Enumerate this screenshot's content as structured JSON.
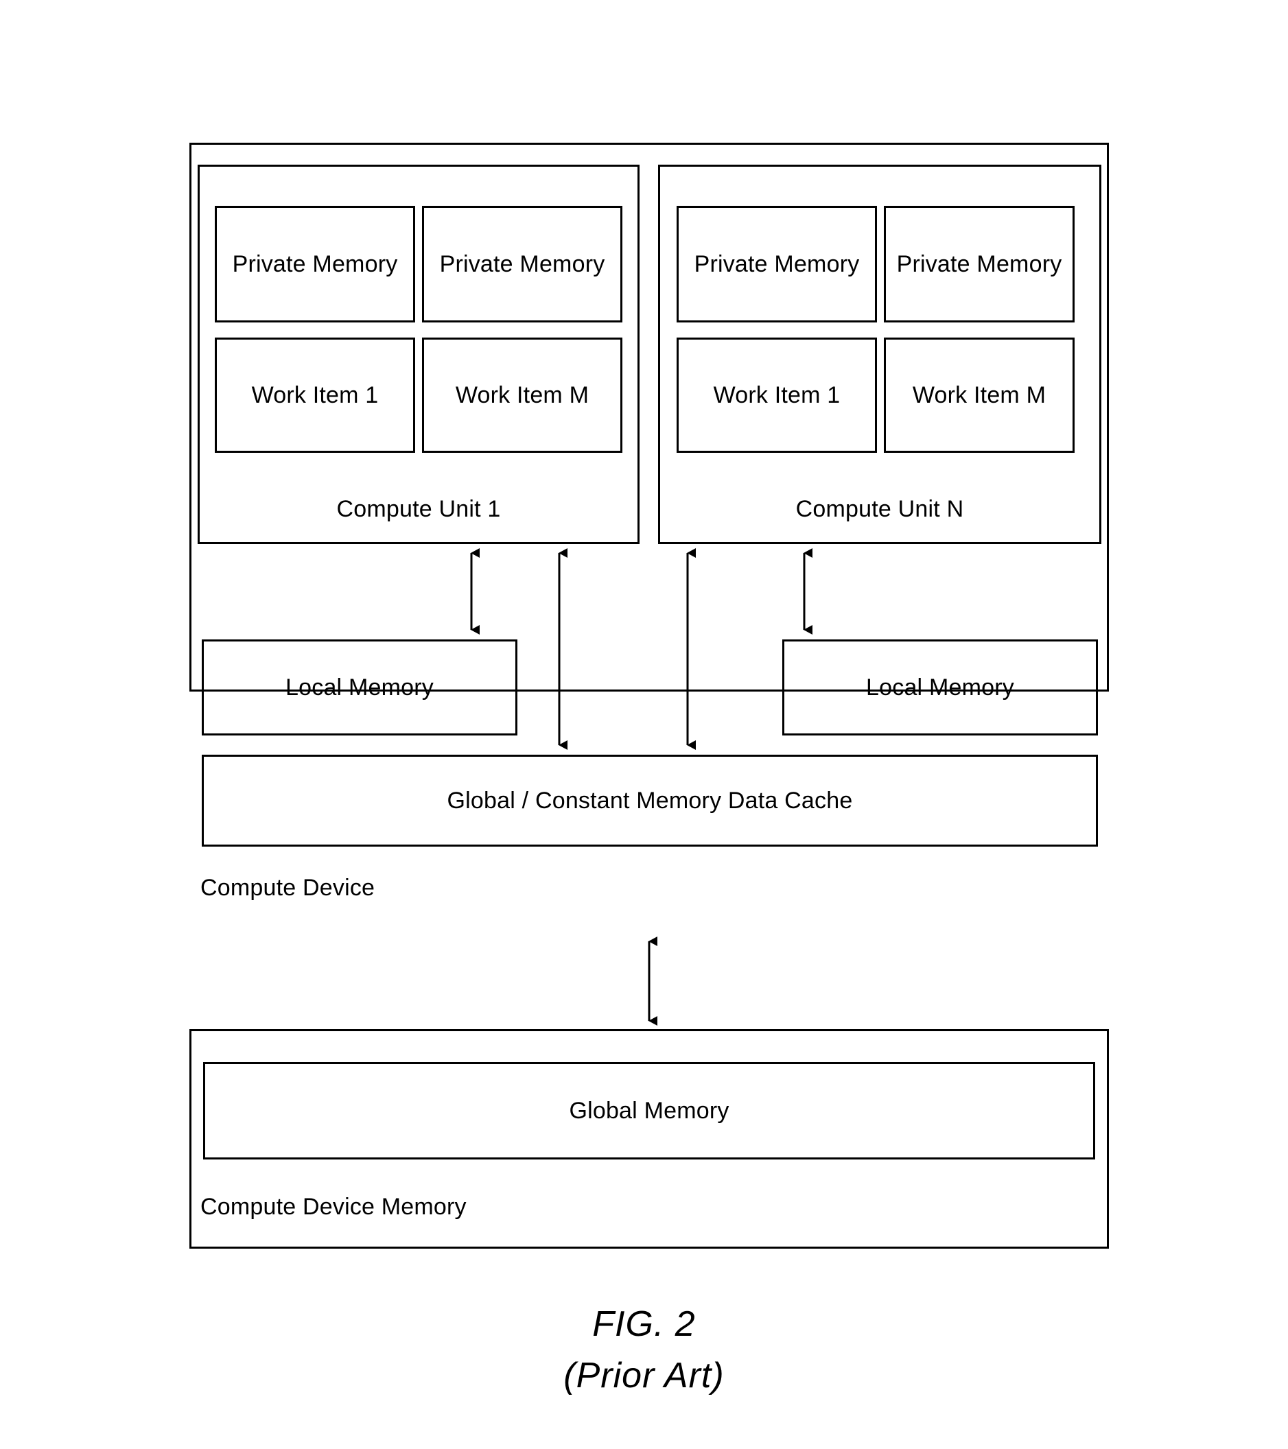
{
  "figure": {
    "caption_line1": "FIG. 2",
    "caption_line2": "(Prior Art)"
  },
  "diagram": {
    "compute_device": {
      "label": "Compute Device",
      "compute_units": [
        {
          "label": "Compute Unit 1",
          "private_memories": [
            "Private Memory",
            "Private Memory"
          ],
          "work_items": [
            "Work Item 1",
            "Work Item M"
          ]
        },
        {
          "label": "Compute Unit N",
          "private_memories": [
            "Private Memory",
            "Private Memory"
          ],
          "work_items": [
            "Work Item 1",
            "Work Item M"
          ]
        }
      ],
      "local_memories": [
        "Local Memory",
        "Local Memory"
      ],
      "cache": "Global / Constant Memory Data Cache"
    },
    "compute_device_memory": {
      "label": "Compute Device Memory",
      "global_memory": "Global Memory"
    }
  },
  "colors": {
    "stroke": "#000000",
    "background": "#ffffff"
  }
}
